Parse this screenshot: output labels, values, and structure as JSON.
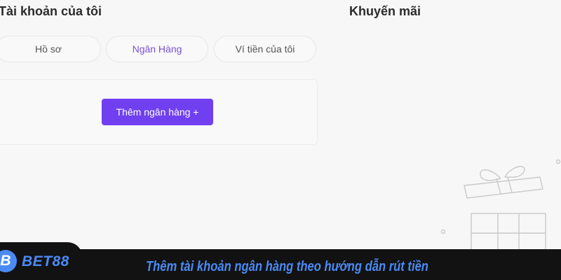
{
  "account": {
    "title": "Tài khoản của tôi"
  },
  "promo": {
    "title": "Khuyến mãi"
  },
  "tabs": [
    {
      "label": "Hồ sơ",
      "active": false
    },
    {
      "label": "Ngân Hàng",
      "active": true
    },
    {
      "label": "Ví tiền của tôi",
      "active": false
    }
  ],
  "bank_panel": {
    "add_button_label": "Thêm ngân hàng +"
  },
  "banner": {
    "logo_letter": "B",
    "logo_text": "BET88",
    "caption": "Thêm tài khoản ngân hàng theo hướng dẫn rút tiền"
  },
  "colors": {
    "accent": "#7040f0",
    "active_tab_text": "#7b4fd6",
    "banner_text": "#4a8af4",
    "banner_bg": "#121212"
  },
  "icons": {
    "promo_illustration": "gift-box-icon"
  }
}
